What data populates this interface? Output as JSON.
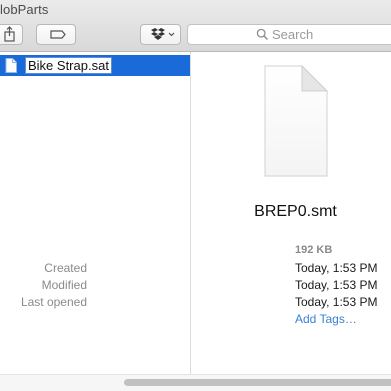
{
  "window": {
    "title": "lobParts"
  },
  "toolbar": {
    "share_icon": "share-icon",
    "tag_icon": "tag-icon",
    "dropbox_icon": "dropbox-icon",
    "search_placeholder": "Search"
  },
  "column": {
    "selected_file_name": "Bike Strap.sat"
  },
  "preview": {
    "file_name": "BREP0.smt",
    "size": "192 KB",
    "info": {
      "created_label": "Created",
      "created_value": "Today, 1:53 PM",
      "modified_label": "Modified",
      "modified_value": "Today, 1:53 PM",
      "last_opened_label": "Last opened",
      "last_opened_value": "Today, 1:53 PM"
    },
    "add_tags": "Add Tags…"
  },
  "colors": {
    "selection": "#1b6ad9",
    "link": "#3a80d7"
  }
}
